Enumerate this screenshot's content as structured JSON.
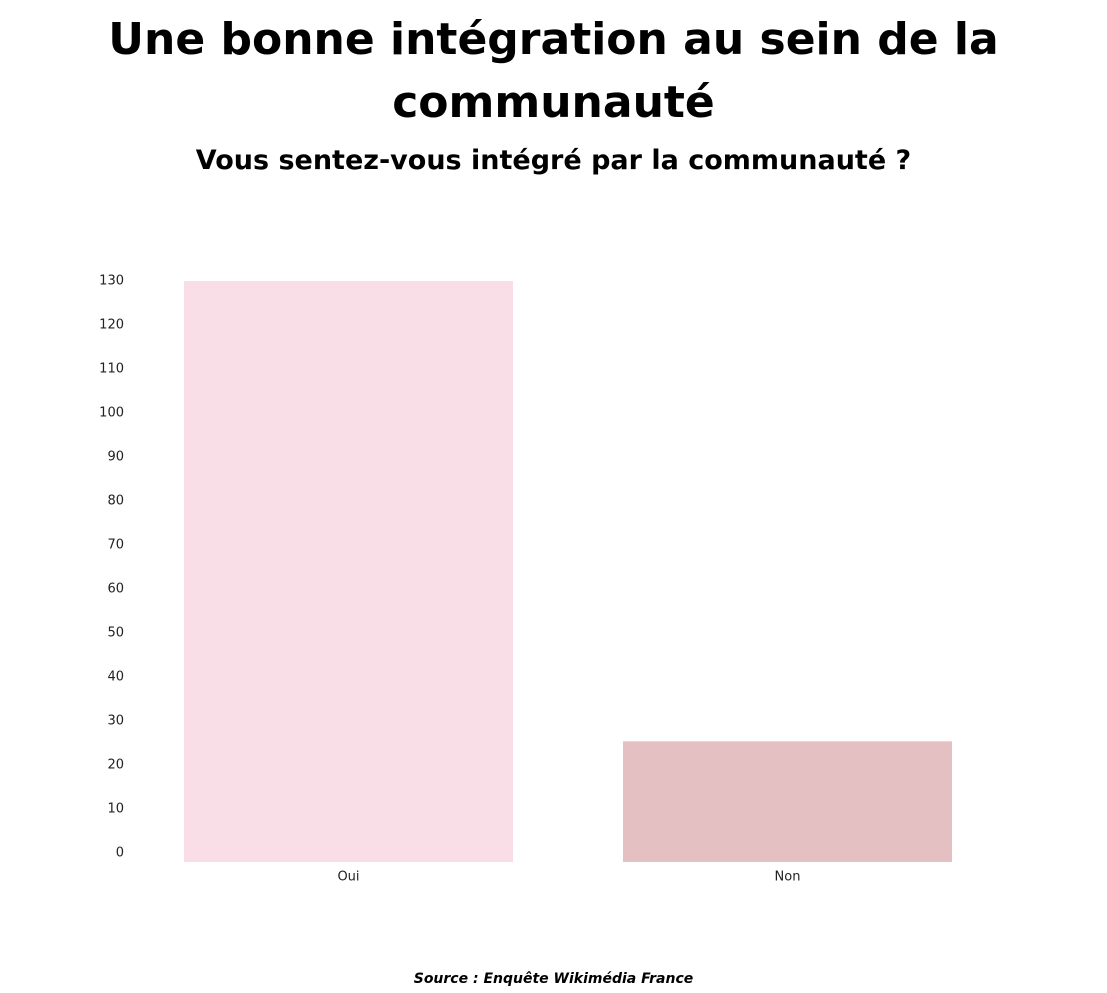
{
  "title": "Une bonne intégration au sein de la communauté",
  "subtitle": "Vous sentez-vous intégré par la communauté ?",
  "source": "Source : Enquête Wikimédia France",
  "colors": {
    "bar_oui": "#f9dde7",
    "bar_non": "#e4c0c2",
    "text": "#222222",
    "background": "#ffffff"
  },
  "chart_data": {
    "type": "bar",
    "categories": [
      "Oui",
      "Non"
    ],
    "values": [
      130,
      27
    ],
    "title": "Vous sentez-vous intégré par la communauté ?",
    "xlabel": "",
    "ylabel": "",
    "ylim": [
      0,
      130
    ],
    "yticks": [
      0,
      10,
      20,
      30,
      40,
      50,
      60,
      70,
      80,
      90,
      100,
      110,
      120,
      130
    ],
    "grid": false,
    "legend": "none"
  }
}
